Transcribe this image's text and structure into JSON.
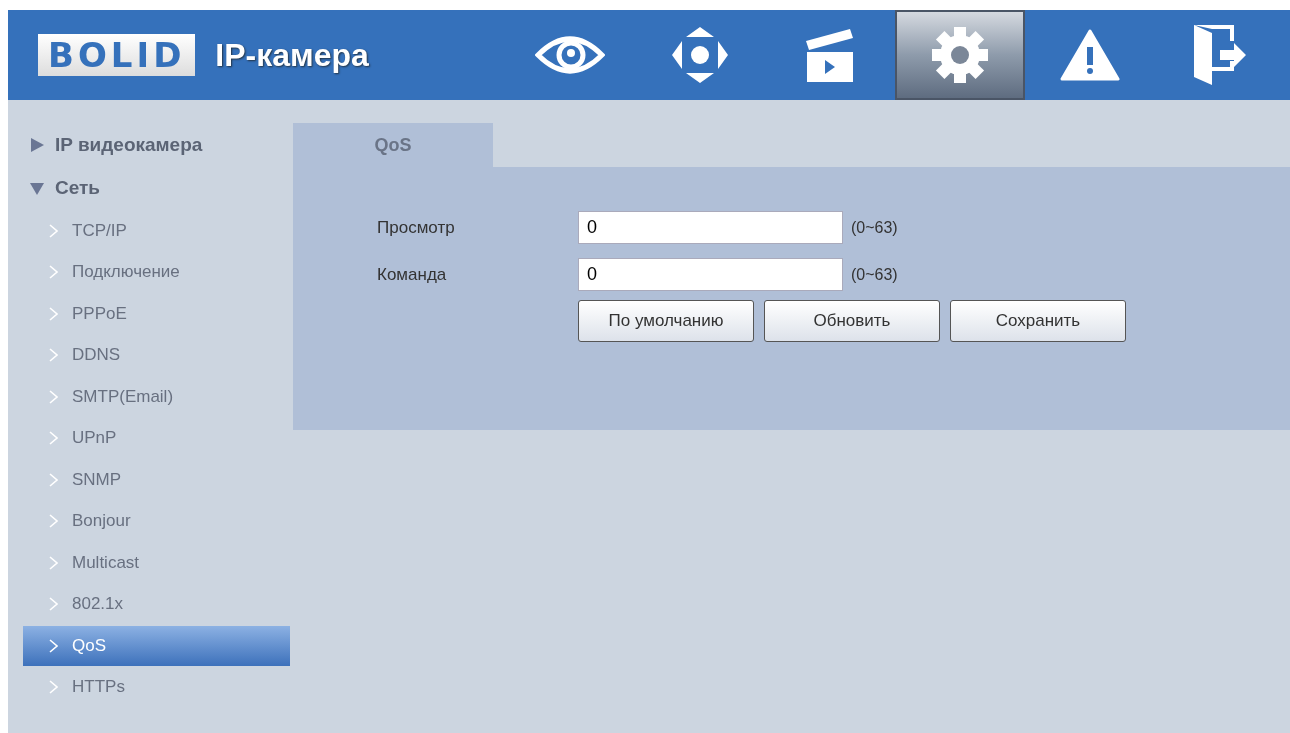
{
  "header": {
    "logo_text": "BOLID",
    "title": "IP-камера"
  },
  "nav": [
    {
      "kind": "eye",
      "selected": false
    },
    {
      "kind": "ptz",
      "selected": false
    },
    {
      "kind": "clapper",
      "selected": false
    },
    {
      "kind": "gear",
      "selected": true
    },
    {
      "kind": "warning",
      "selected": false
    },
    {
      "kind": "exit",
      "selected": false
    }
  ],
  "sidebar": {
    "items": [
      {
        "label": "IP видеокамера",
        "expanded": false
      },
      {
        "label": "Сеть",
        "expanded": true,
        "children": [
          {
            "label": "TCP/IP",
            "selected": false
          },
          {
            "label": "Подключение",
            "selected": false
          },
          {
            "label": "PPPoE",
            "selected": false
          },
          {
            "label": "DDNS",
            "selected": false
          },
          {
            "label": "SMTP(Email)",
            "selected": false
          },
          {
            "label": "UPnP",
            "selected": false
          },
          {
            "label": "SNMP",
            "selected": false
          },
          {
            "label": "Bonjour",
            "selected": false
          },
          {
            "label": "Multicast",
            "selected": false
          },
          {
            "label": "802.1x",
            "selected": false
          },
          {
            "label": "QoS",
            "selected": true
          },
          {
            "label": "HTTPs",
            "selected": false
          }
        ]
      }
    ]
  },
  "tabs": [
    {
      "label": "QoS",
      "selected": true
    }
  ],
  "form": {
    "fields": [
      {
        "label": "Просмотр",
        "value": "0",
        "range": "(0~63)"
      },
      {
        "label": "Команда",
        "value": "0",
        "range": "(0~63)"
      }
    ],
    "buttons": [
      "По умолчанию",
      "Обновить",
      "Сохранить"
    ]
  }
}
